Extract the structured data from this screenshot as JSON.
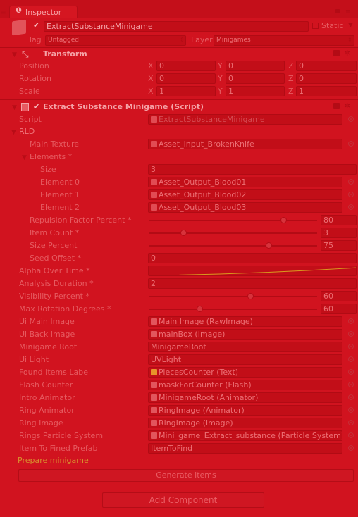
{
  "tab": {
    "label": "Inspector"
  },
  "gameobject": {
    "name": "ExtractSubstanceMinigame",
    "static_label": "Static",
    "tag_label": "Tag",
    "tag_value": "Untagged",
    "layer_label": "Layer",
    "layer_value": "Minigames"
  },
  "transform": {
    "title": "Transform",
    "rows": [
      {
        "label": "Position",
        "x": "0",
        "y": "0",
        "z": "0"
      },
      {
        "label": "Rotation",
        "x": "0",
        "y": "0",
        "z": "0"
      },
      {
        "label": "Scale",
        "x": "1",
        "y": "1",
        "z": "1"
      }
    ],
    "axis_x": "X",
    "axis_y": "Y",
    "axis_z": "Z"
  },
  "script_component": {
    "title": "Extract Substance Minigame (Script)",
    "script_label": "Script",
    "script_value": "ExtractSubstanceMinigame",
    "rld_label": "RLD",
    "main_texture_label": "Main Texture",
    "main_texture_value": "Asset_Input_BrokenKnife",
    "elements_label": "Elements *",
    "size_label": "Size",
    "size_value": "3",
    "elements": [
      {
        "label": "Element 0",
        "value": "Asset_Output_Blood01"
      },
      {
        "label": "Element 1",
        "value": "Asset_Output_Blood02"
      },
      {
        "label": "Element 2",
        "value": "Asset_Output_Blood03"
      }
    ],
    "repulsion_label": "Repulsion Factor Percent *",
    "repulsion_value": "80",
    "repulsion_fraction": 0.8,
    "item_count_label": "Item Count *",
    "item_count_value": "3",
    "item_count_fraction": 0.2,
    "size_percent_label": "Size Percent",
    "size_percent_value": "75",
    "size_percent_fraction": 0.71,
    "seed_offset_label": "Seed Offset *",
    "seed_offset_value": "0",
    "alpha_curve_label": "Alpha Over Time *",
    "analysis_label": "Analysis Duration *",
    "analysis_value": "2",
    "visibility_label": "Visibility Percent *",
    "visibility_value": "60",
    "visibility_fraction": 0.6,
    "max_rotation_label": "Max Rotation Degrees *",
    "max_rotation_value": "60",
    "max_rotation_fraction": 0.3,
    "refs": [
      {
        "label": "Ui Main Image",
        "value": "Main Image (RawImage)",
        "icon": "image-icon"
      },
      {
        "label": "Ui Back Image",
        "value": "mainBox (Image)",
        "icon": "image-icon"
      },
      {
        "label": "Minigame Root",
        "value": "MinigameRoot",
        "icon": ""
      },
      {
        "label": "Ui Light",
        "value": "UVLight",
        "icon": ""
      },
      {
        "label": "Found Items Label",
        "value": "PiecesCounter (Text)",
        "icon": "text-icon"
      },
      {
        "label": "Flash Counter",
        "value": "maskForCounter (Flash)",
        "icon": "script-icon"
      },
      {
        "label": "Intro Animator",
        "value": "MinigameRoot (Animator)",
        "icon": "animator-icon"
      },
      {
        "label": "Ring Animator",
        "value": "RingImage (Animator)",
        "icon": "animator-icon"
      },
      {
        "label": "Ring Image",
        "value": "RingImage (Image)",
        "icon": "image-icon"
      },
      {
        "label": "Rings Particle System",
        "value": "Mini_game_Extract_substance (Particle System)",
        "icon": "particle-icon"
      },
      {
        "label": "Item To Fined Prefab",
        "value": "ItemToFind",
        "icon": ""
      }
    ],
    "prepare_label": "Prepare minigame",
    "generate_label": "Generate items"
  },
  "add_component_label": "Add Component"
}
